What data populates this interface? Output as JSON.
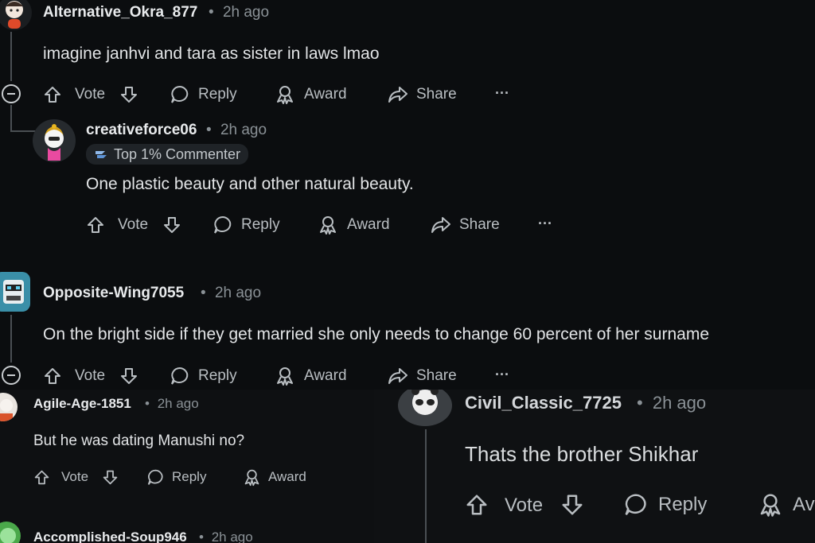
{
  "main": {
    "comment1": {
      "username": "Alternative_Okra_877",
      "time": "2h ago",
      "text": "imagine janhvi and tara as sister in laws lmao",
      "actions": {
        "vote": "Vote",
        "reply": "Reply",
        "award": "Award",
        "share": "Share",
        "more": "···"
      }
    },
    "reply1": {
      "username": "creativeforce06",
      "time": "2h ago",
      "badge": "Top 1% Commenter",
      "text": "One plastic beauty and other natural beauty.",
      "actions": {
        "vote": "Vote",
        "reply": "Reply",
        "award": "Award",
        "share": "Share",
        "more": "···"
      }
    },
    "comment2": {
      "username": "Opposite-Wing7055",
      "time": "2h ago",
      "text": "On the bright side if they get married she only needs to change 60 percent of her surname",
      "actions": {
        "vote": "Vote",
        "reply": "Reply",
        "award": "Award",
        "share": "Share",
        "more": "···"
      }
    }
  },
  "bottom_left": {
    "comment": {
      "username": "Agile-Age-1851",
      "time": "2h ago",
      "text": "But he was dating Manushi no?",
      "actions": {
        "vote": "Vote",
        "reply": "Reply",
        "award": "Award"
      }
    },
    "next_username": "Accomplished-Soup946",
    "next_time": "2h ago"
  },
  "bottom_right": {
    "comment": {
      "username": "Civil_Classic_7725",
      "time": "2h ago",
      "text": "Thats the brother Shikhar",
      "actions": {
        "vote": "Vote",
        "reply": "Reply",
        "award": "Av"
      }
    }
  },
  "separator": "•",
  "colors": {
    "background": "#0b0d0f",
    "text": "#d7dadc",
    "muted": "#8a9196",
    "badge_bg": "#1f2327"
  }
}
